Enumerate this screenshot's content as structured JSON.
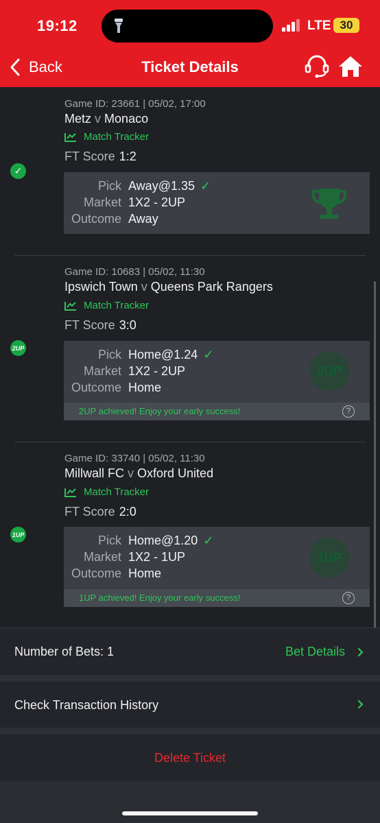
{
  "status": {
    "time": "19:12",
    "network": "LTE",
    "battery": "30"
  },
  "nav": {
    "back_label": "Back",
    "title": "Ticket Details"
  },
  "bets": [
    {
      "game_id": "Game ID: 23661 | 05/02, 17:00",
      "home": "Metz",
      "vs": "v",
      "away": "Monaco",
      "tracker": "Match Tracker",
      "score_label": "FT Score",
      "score": "1:2",
      "pick_label": "Pick",
      "pick": "Away@1.35",
      "market_label": "Market",
      "market": "1X2 - 2UP",
      "outcome_label": "Outcome",
      "outcome": "Away",
      "status_badge": "✓",
      "watermark": "🏆",
      "achievement": ""
    },
    {
      "game_id": "Game ID: 10683 | 05/02, 11:30",
      "home": "Ipswich Town",
      "vs": "v",
      "away": "Queens Park Rangers",
      "tracker": "Match Tracker",
      "score_label": "FT Score",
      "score": "3:0",
      "pick_label": "Pick",
      "pick": "Home@1.24",
      "market_label": "Market",
      "market": "1X2 - 2UP",
      "outcome_label": "Outcome",
      "outcome": "Home",
      "status_badge": "2UP",
      "watermark": "2UP",
      "achievement": "2UP achieved! Enjoy your early success!"
    },
    {
      "game_id": "Game ID: 33740 | 05/02, 11:30",
      "home": "Millwall FC",
      "vs": "v",
      "away": "Oxford United",
      "tracker": "Match Tracker",
      "score_label": "FT Score",
      "score": "2:0",
      "pick_label": "Pick",
      "pick": "Home@1.20",
      "market_label": "Market",
      "market": "1X2 - 1UP",
      "outcome_label": "Outcome",
      "outcome": "Home",
      "status_badge": "1UP",
      "watermark": "1UP",
      "achievement": "1UP achieved! Enjoy your early success!"
    }
  ],
  "summary": {
    "bets_count_label": "Number of Bets: 1",
    "details_label": "Bet Details"
  },
  "transactions": {
    "label": "Check Transaction History"
  },
  "delete": {
    "label": "Delete Ticket"
  },
  "colors": {
    "brand_red": "#e41b23",
    "success_green": "#2fc65a",
    "background": "#1e2024"
  }
}
